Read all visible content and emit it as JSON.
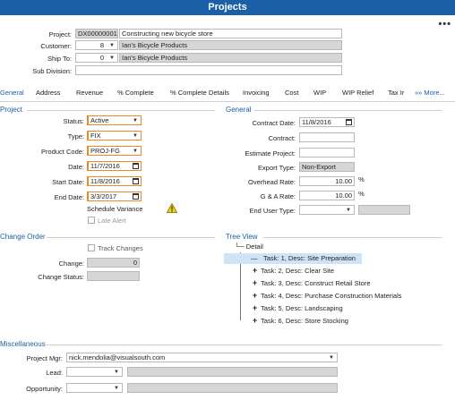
{
  "app": {
    "title": "Projects",
    "more_menu": "•••"
  },
  "header": {
    "project_label": "Project:",
    "project_id": "DX00000001",
    "project_desc": "Constructing new bicycle store",
    "customer_label": "Customer:",
    "customer_id": "8",
    "customer_name": "Ian's Bicycle Products",
    "shipto_label": "Ship To:",
    "shipto_id": "0",
    "shipto_name": "Ian's Bicycle Products",
    "subdivision_label": "Sub Division:",
    "subdivision_value": ""
  },
  "tabs": [
    {
      "label": "General"
    },
    {
      "label": "Address"
    },
    {
      "label": "Revenue"
    },
    {
      "label": "% Complete"
    },
    {
      "label": "% Complete Details"
    },
    {
      "label": "Invoicing"
    },
    {
      "label": "Cost"
    },
    {
      "label": "WIP"
    },
    {
      "label": "WIP Relief"
    },
    {
      "label": "Tax Ir"
    },
    {
      "label": "»» More..."
    }
  ],
  "project_section": {
    "title": "Project",
    "status_label": "Status:",
    "status": "Active",
    "type_label": "Type:",
    "type": "FIX",
    "product_code_label": "Product Code:",
    "product_code": "PROJ-FG",
    "date_label": "Date:",
    "date": "11/7/2016",
    "start_date_label": "Start Date:",
    "start_date": "11/8/2016",
    "end_date_label": "End Date:",
    "end_date": "3/3/2017",
    "schedule_variance": "Schedule Variance",
    "late_alert": "Late Alert"
  },
  "general_section": {
    "title": "General",
    "contract_date_label": "Contract Date:",
    "contract_date": "11/8/2016",
    "contract_label": "Contract:",
    "contract": "",
    "estimate_label": "Estimate Project:",
    "estimate": "",
    "export_type_label": "Export Type:",
    "export_type": "Non-Export",
    "overhead_label": "Overhead Rate:",
    "overhead": "10.00",
    "overhead_unit": "%",
    "ga_label": "G & A Rate:",
    "ga": "10.00",
    "ga_unit": "%",
    "end_user_label": "End User Type:",
    "end_user": ""
  },
  "change_order": {
    "title": "Change Order",
    "track_changes": "Track Changes",
    "change_label": "Change:",
    "change": "0",
    "change_status_label": "Change Status:",
    "change_status": ""
  },
  "tree_view": {
    "title": "Tree View",
    "root": "Detail",
    "items": [
      {
        "label": "Task: 1, Desc: Site Preparation"
      },
      {
        "label": "Task: 2, Desc: Clear Site"
      },
      {
        "label": "Task: 3, Desc: Construct Retail Store"
      },
      {
        "label": "Task: 4, Desc: Purchase Construction Materials"
      },
      {
        "label": "Task: 5, Desc: Landscaping"
      },
      {
        "label": "Task: 6, Desc: Store Stocking"
      }
    ]
  },
  "misc": {
    "title": "Miscellaneous",
    "pm_label": "Project Mgr:",
    "pm": "nick.mendolia@visualsouth.com",
    "lead_label": "Lead:",
    "lead": "",
    "opp_label": "Opportunity:",
    "opp": ""
  },
  "colors": {
    "accent": "#1a5fa8",
    "required": "#e98a2a",
    "selected": "#cfe3f7",
    "warning": "#f2d400"
  }
}
